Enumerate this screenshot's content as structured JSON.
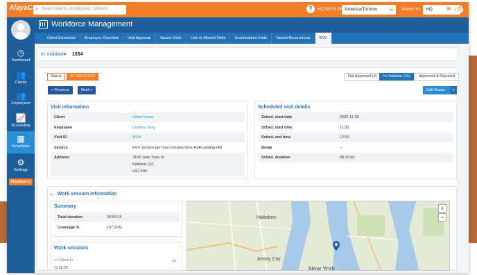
{
  "topbar": {
    "logo": "AlayaCare",
    "search_placeholder": "Search clients, employees, contacts",
    "help": "?",
    "location_time": "HQ 08:05 PM",
    "timezone": "America/Toronto",
    "switch_to_label": "Switch to",
    "switch_to_value": "HQ"
  },
  "sidebar": {
    "items": [
      {
        "label": "Dashboard",
        "icon": "dashboard-icon"
      },
      {
        "label": "Clients",
        "icon": "clients-icon"
      },
      {
        "label": "Employees",
        "icon": "employees-icon"
      },
      {
        "label": "Accounting",
        "icon": "accounting-icon"
      },
      {
        "label": "Schedules",
        "icon": "schedules-icon"
      },
      {
        "label": "Settings",
        "icon": "settings-icon"
      }
    ],
    "app_badge": "AlayaCare U"
  },
  "header": {
    "title": "Workforce Management"
  },
  "tabs": [
    "Client Schedules",
    "Employee Overview",
    "Visit Approval",
    "Vacant Visits",
    "Late or Missed Visits",
    "Unscheduled Visits",
    "Vacant Recurrences",
    "EVV"
  ],
  "breadcrumb": {
    "parent": "In Violation",
    "separator": ">",
    "current": "1634"
  },
  "status": {
    "label": "Status",
    "value": "IN VIOLATION"
  },
  "filters": [
    {
      "label": "Not Approved (0)"
    },
    {
      "label": "In Violation (24)"
    },
    {
      "label": "Approved & Rejected"
    }
  ],
  "pager": {
    "previous": "< Previous",
    "next": "Next >"
  },
  "edit_status": {
    "label": "Edit Status",
    "caret": "▾"
  },
  "visit_info": {
    "title": "Visit information",
    "rows": [
      {
        "key": "Client",
        "value": "Helen Iruma",
        "link": true
      },
      {
        "key": "Employee",
        "value": "Cristina Yang",
        "link": true
      },
      {
        "key": "Visit ID",
        "value": "1634",
        "link": true
      },
      {
        "key": "Service",
        "value": "EVV Service-per hour-Clocked time-NoRounding-HQ",
        "link": false
      },
      {
        "key": "Address",
        "value_lines": [
          "3100 Jean Yves St",
          "Kirkland, QC",
          "H9J 2R6"
        ],
        "link": false
      }
    ]
  },
  "scheduled": {
    "title": "Scheduled visit details",
    "rows": [
      {
        "key": "Sched. start date",
        "value": "2020-11-05"
      },
      {
        "key": "Sched. start time",
        "value": "11:30"
      },
      {
        "key": "Sched. end time",
        "value": "12:00"
      },
      {
        "key": "Break",
        "value": "--"
      },
      {
        "key": "Sched. duration",
        "value": "00:30:00"
      }
    ]
  },
  "work_session": {
    "title": "Work session information",
    "summary_title": "Summary",
    "summary": [
      {
        "key": "Total duration",
        "value": "00:59:15"
      },
      {
        "key": "Coverage %",
        "value": "197.50%"
      }
    ],
    "sessions_title": "Work sessions",
    "clock_in": "+1 Clock in",
    "clock_time": "11:29"
  },
  "map": {
    "labels": [
      "Hoboken",
      "Jersey City",
      "New York"
    ],
    "zoom_in": "+",
    "zoom_out": "−"
  },
  "colors": {
    "topbar": "#f47d2a",
    "header": "#1c5e99",
    "accent": "#2a8ed4",
    "status": "#f47d2a"
  }
}
